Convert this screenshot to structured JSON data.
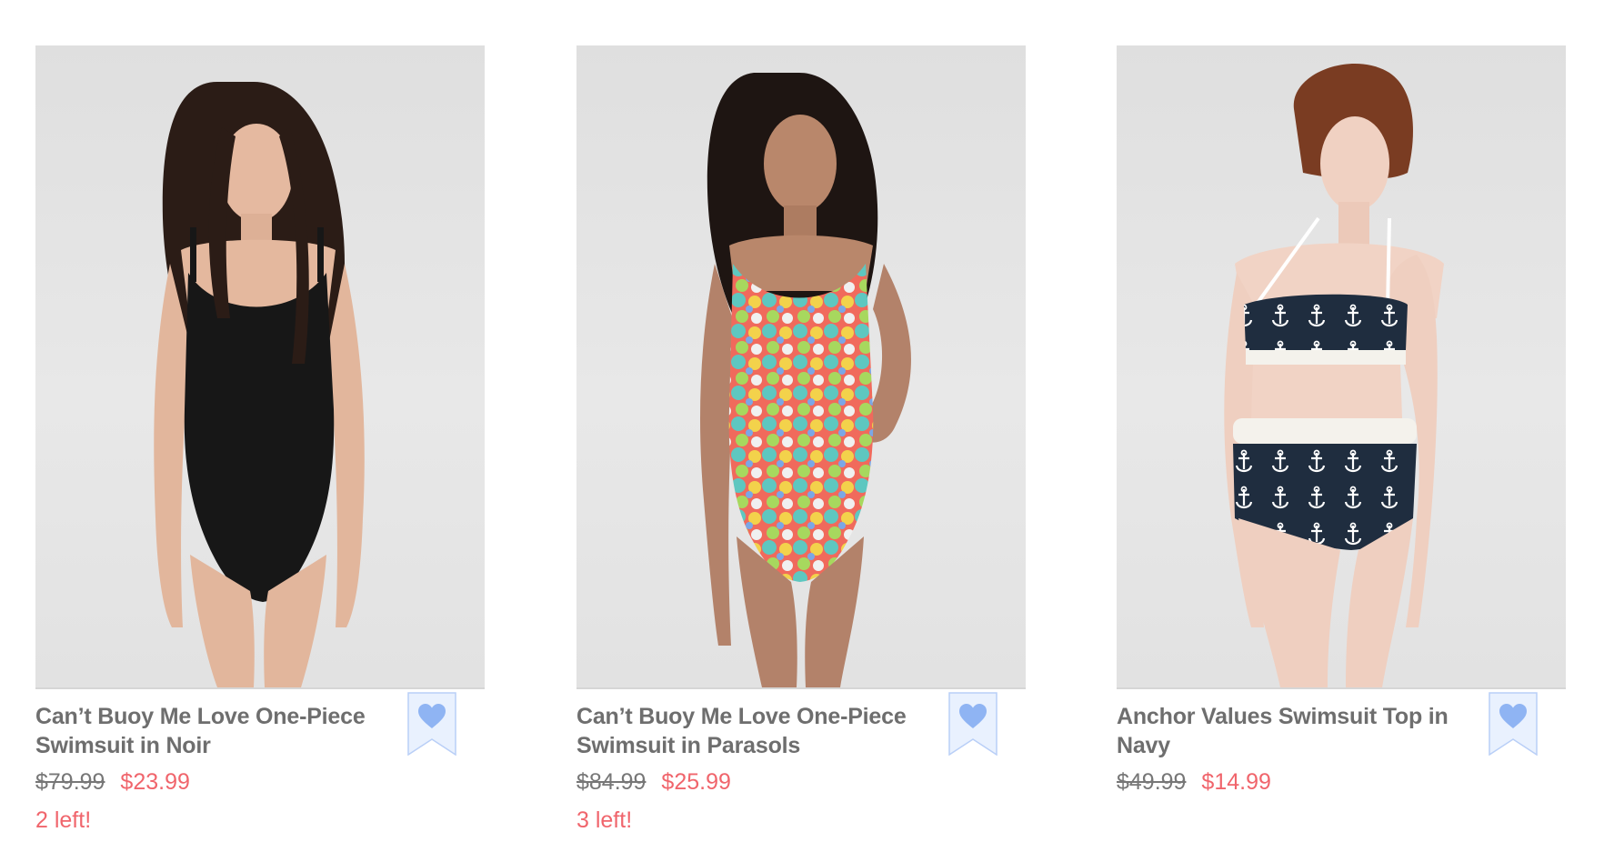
{
  "products": [
    {
      "title": "Can’t Buoy Me Love One-Piece Swimsuit in Noir",
      "original_price": "$79.99",
      "sale_price": "$23.99",
      "stock_note": "2 left!"
    },
    {
      "title": "Can’t Buoy Me Love One-Piece Swimsuit in Parasols",
      "original_price": "$84.99",
      "sale_price": "$25.99",
      "stock_note": "3 left!"
    },
    {
      "title": "Anchor Values Swimsuit Top in Navy",
      "original_price": "$49.99",
      "sale_price": "$14.99",
      "stock_note": ""
    }
  ],
  "colors": {
    "title_text": "#6e6e6e",
    "original_price": "#777777",
    "sale_price": "#f0656c",
    "stock_note": "#f0656c",
    "favorite_heart": "#8fb4f3",
    "favorite_ribbon": "#e9f1fe"
  },
  "icons": {
    "favorite": "heart-ribbon-icon"
  }
}
